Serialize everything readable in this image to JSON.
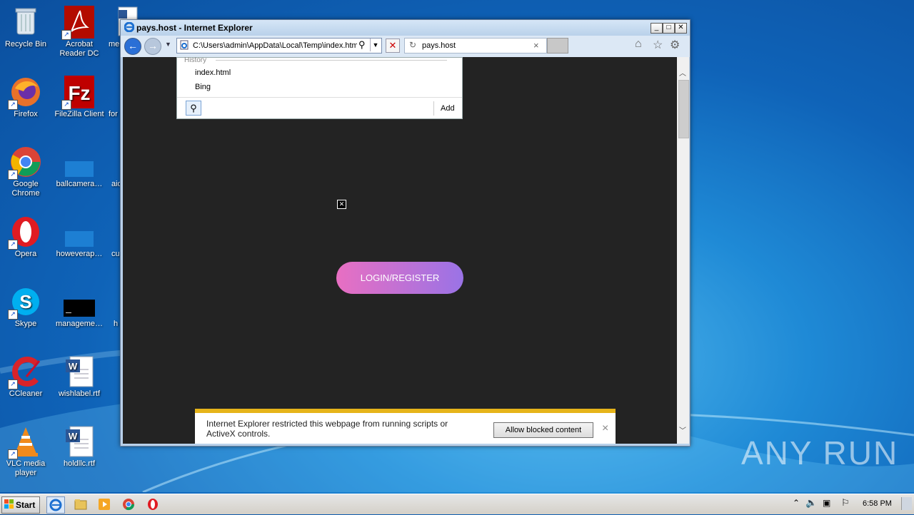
{
  "desktop": {
    "icons": [
      {
        "label": "Recycle Bin"
      },
      {
        "label": "Acrobat Reader DC"
      },
      {
        "label": "me"
      },
      {
        "label": "Firefox"
      },
      {
        "label": "FileZilla Client"
      },
      {
        "label": "for"
      },
      {
        "label": "Google Chrome"
      },
      {
        "label": "ballcamera…"
      },
      {
        "label": "aid"
      },
      {
        "label": "Opera"
      },
      {
        "label": "howeverap…"
      },
      {
        "label": "cu"
      },
      {
        "label": "Skype"
      },
      {
        "label": "manageme…"
      },
      {
        "label": "h"
      },
      {
        "label": "CCleaner"
      },
      {
        "label": "wishlabel.rtf"
      },
      {
        "label": "VLC media player"
      },
      {
        "label": "holdllc.rtf"
      }
    ]
  },
  "window": {
    "title": "pays.host - Internet Explorer",
    "buttons": {
      "minimize": "_",
      "maximize": "□",
      "close": "✕"
    },
    "address": "C:\\Users\\admin\\AppData\\Local\\Temp\\index.htm",
    "tab_title": "pays.host",
    "tab_close": "×"
  },
  "dropdown": {
    "section": "History",
    "items": [
      "index.html",
      "Bing"
    ],
    "add_label": "Add"
  },
  "page": {
    "close_glyph": "✕",
    "login_button": "LOGIN/REGISTER"
  },
  "infobar": {
    "message": "Internet Explorer restricted this webpage from running scripts or ActiveX controls.",
    "allow_button": "Allow blocked content",
    "close": "×"
  },
  "taskbar": {
    "start_label": "Start",
    "clock": "6:58 PM"
  },
  "watermark": "ANY RUN"
}
